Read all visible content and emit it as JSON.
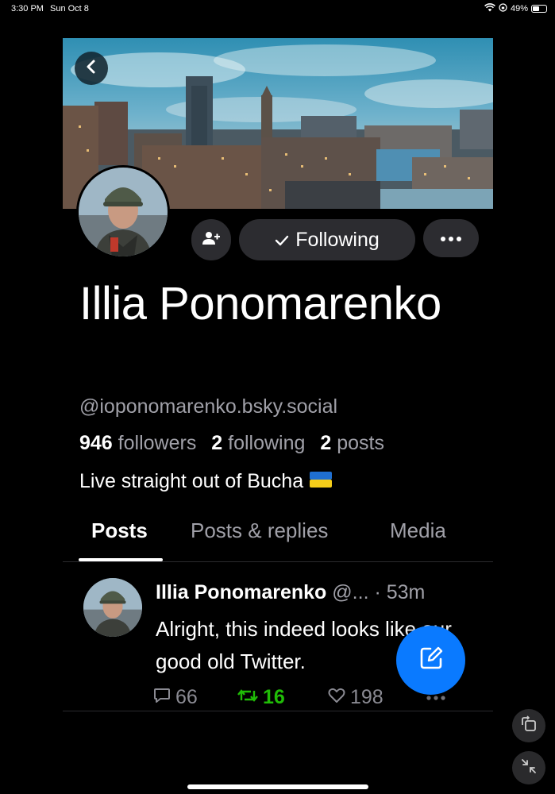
{
  "status_bar": {
    "time": "3:30 PM",
    "date": "Sun Oct 8",
    "battery": "49%",
    "battery_level": 0.49,
    "icons": [
      "wifi-icon",
      "orientation-lock-icon",
      "battery-icon"
    ]
  },
  "profile": {
    "display_name": "Illia Ponomarenko",
    "handle": "@ioponomarenko.bsky.social",
    "followers_count": "946",
    "followers_label": "followers",
    "following_count": "2",
    "following_label": "following",
    "posts_count": "2",
    "posts_label": "posts",
    "bio": "Live straight out of Bucha",
    "bio_emoji": "ukraine-flag-emoji"
  },
  "actions": {
    "following_label": "Following",
    "icons": [
      "back-icon",
      "add-user-icon",
      "checkmark-icon",
      "more-icon"
    ]
  },
  "tabs": [
    {
      "label": "Posts",
      "active": true
    },
    {
      "label": "Posts & replies",
      "active": false
    },
    {
      "label": "Media",
      "active": false
    }
  ],
  "post": {
    "author": "Illia Ponomarenko",
    "handle": "@...",
    "separator": "·",
    "time": "53m",
    "text": "Alright, this indeed looks like our good old Twitter.",
    "reply_count": "66",
    "repost_count": "16",
    "like_count": "198"
  },
  "bottom_nav": [
    "home-icon",
    "search-icon",
    "feeds-hashtag-icon",
    "notifications-icon",
    "profile-avatar"
  ],
  "colors": {
    "background": "#000000",
    "button_bg": "#2c2c30",
    "secondary_text": "#a0a0a8",
    "accent": "#0a7aff",
    "repost_active": "#20bc07"
  }
}
